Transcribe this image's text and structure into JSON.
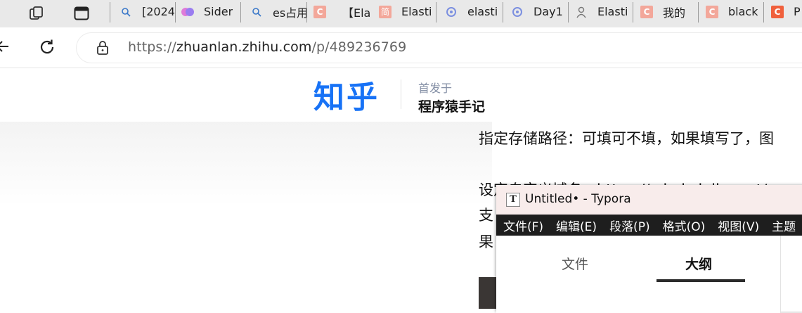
{
  "browser": {
    "tabs": [
      {
        "icon": "search-icon",
        "label": "[2024"
      },
      {
        "icon": "sider-brain-icon",
        "label": "Sider"
      },
      {
        "icon": "search-icon",
        "label": "es占用"
      },
      {
        "icon": "csdn-c-icon",
        "label": ""
      },
      {
        "icon": "",
        "label": "【Ela"
      },
      {
        "icon": "jianshu-icon",
        "label": "Elasti"
      },
      {
        "icon": "cnblogs-icon",
        "label": "elasti"
      },
      {
        "icon": "cnblogs-icon",
        "label": "Day1"
      },
      {
        "icon": "user-icon",
        "label": "Elasti"
      },
      {
        "icon": "csdn-c-icon",
        "label": "我的"
      },
      {
        "icon": "csdn-c-icon",
        "label": "black"
      },
      {
        "icon": "csdn-c-icon",
        "label": "P"
      }
    ],
    "jianshu_glyph": "简",
    "csdn_glyph": "C",
    "url_scheme": "https://",
    "url_domain": "zhuanlan.zhihu.com",
    "url_path": "/p/489236769"
  },
  "zhihu": {
    "logo": "知乎",
    "published_in": "首发于",
    "column_name": "程序猿手记",
    "brand_color": "#1772f6"
  },
  "article": {
    "line1": "指定存储路径：可填可不填，如果填写了，图",
    "line2": "设定自定义域名：https://cdn.jsdelivr.net/g",
    "line3": "支",
    "line4": "果"
  },
  "typora": {
    "icon_letter": "T",
    "title": "Untitled• - Typora",
    "menu": [
      "文件(F)",
      "编辑(E)",
      "段落(P)",
      "格式(O)",
      "视图(V)",
      "主题"
    ],
    "sidebar_tabs": {
      "files": "文件",
      "outline": "大纲"
    }
  }
}
